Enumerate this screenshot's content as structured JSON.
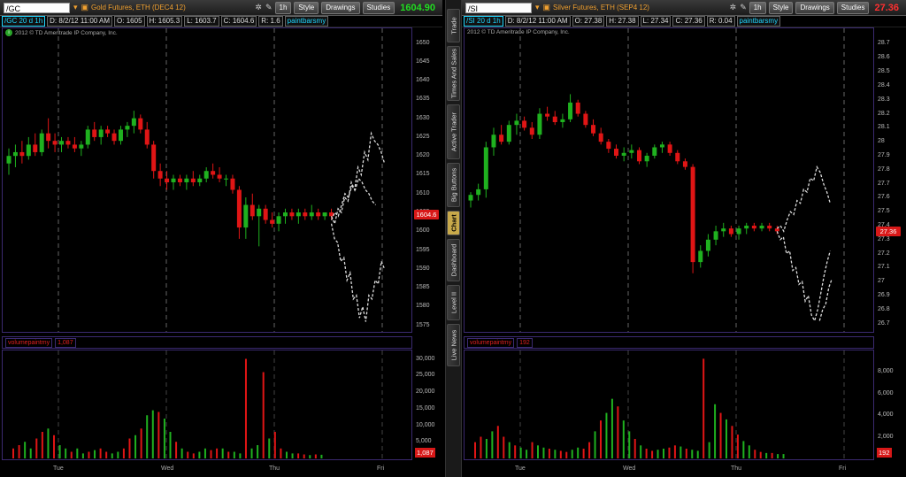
{
  "panels": [
    {
      "id": "gold",
      "symbol": "/GC",
      "description": "Gold Futures, ETH (DEC4 12)",
      "interval_btn": "1h",
      "style_btn": "Style",
      "drawings_btn": "Drawings",
      "studies_btn": "Studies",
      "price": "1604.90",
      "price_color": "#22dd22",
      "change": "",
      "quote": {
        "sym": "/GC 20 d 1h",
        "date": "D: 8/2/12 11:00 AM",
        "open": "O: 1605",
        "high": "H: 1605.3",
        "low": "L: 1603.7",
        "close": "C: 1604.6",
        "range": "R: 1.6",
        "study": "paintbarsmy"
      },
      "copyright": "2012 © TD Ameritrade IP Company, Inc.",
      "yticks": [
        "1650",
        "1645",
        "1640",
        "1635",
        "1630",
        "1625",
        "1620",
        "1615",
        "1610",
        "1605",
        "1600",
        "1595",
        "1590",
        "1585",
        "1580",
        "1575"
      ],
      "ymin": 1574,
      "ymax": 1652,
      "last_label": "1604.6",
      "last_value": 1604.6,
      "volume_study": "volumepaintmy",
      "volume_value": "1,087",
      "vol_ticks": [
        "30,000",
        "25,000",
        "20,000",
        "15,000",
        "10,000",
        "5,000"
      ],
      "vol_max": 32000,
      "xticks": [
        "Tue",
        "Wed",
        "Thu",
        "Fri"
      ],
      "candles": [
        [
          1618,
          1622,
          1615,
          1620
        ],
        [
          1620,
          1623,
          1617,
          1621
        ],
        [
          1621,
          1624,
          1618,
          1620
        ],
        [
          1620,
          1625,
          1619,
          1623
        ],
        [
          1623,
          1626,
          1620,
          1621
        ],
        [
          1621,
          1627,
          1620,
          1626
        ],
        [
          1626,
          1630,
          1622,
          1624
        ],
        [
          1624,
          1626,
          1621,
          1623
        ],
        [
          1623,
          1625,
          1621,
          1624
        ],
        [
          1624,
          1625,
          1622,
          1623
        ],
        [
          1623,
          1625,
          1621,
          1622
        ],
        [
          1622,
          1624,
          1620,
          1623
        ],
        [
          1623,
          1628,
          1622,
          1627
        ],
        [
          1627,
          1629,
          1624,
          1625
        ],
        [
          1625,
          1628,
          1623,
          1627
        ],
        [
          1627,
          1628,
          1625,
          1626
        ],
        [
          1626,
          1627,
          1623,
          1624
        ],
        [
          1624,
          1628,
          1623,
          1627
        ],
        [
          1627,
          1629,
          1625,
          1628
        ],
        [
          1628,
          1632,
          1626,
          1630
        ],
        [
          1630,
          1631,
          1626,
          1627
        ],
        [
          1627,
          1629,
          1622,
          1623
        ],
        [
          1623,
          1624,
          1614,
          1616
        ],
        [
          1616,
          1618,
          1612,
          1614
        ],
        [
          1614,
          1616,
          1611,
          1613
        ],
        [
          1613,
          1615,
          1611,
          1614
        ],
        [
          1614,
          1615,
          1612,
          1613
        ],
        [
          1613,
          1615,
          1611,
          1614
        ],
        [
          1614,
          1616,
          1612,
          1613
        ],
        [
          1613,
          1615,
          1612,
          1614
        ],
        [
          1614,
          1617,
          1613,
          1616
        ],
        [
          1616,
          1618,
          1614,
          1615
        ],
        [
          1615,
          1617,
          1613,
          1614
        ],
        [
          1614,
          1615,
          1612,
          1614
        ],
        [
          1614,
          1615,
          1610,
          1611
        ],
        [
          1611,
          1612,
          1598,
          1601
        ],
        [
          1601,
          1609,
          1598,
          1607
        ],
        [
          1607,
          1610,
          1603,
          1604
        ],
        [
          1604,
          1607,
          1596,
          1606
        ],
        [
          1606,
          1607,
          1602,
          1603
        ],
        [
          1603,
          1605,
          1601,
          1602
        ],
        [
          1602,
          1605,
          1600,
          1604
        ],
        [
          1604,
          1606,
          1602,
          1605
        ],
        [
          1605,
          1606,
          1603,
          1604
        ],
        [
          1604,
          1606,
          1602,
          1605
        ],
        [
          1605,
          1606,
          1603,
          1604
        ],
        [
          1604,
          1607,
          1603,
          1605
        ],
        [
          1605,
          1606,
          1603,
          1604
        ],
        [
          1604,
          1605,
          1603,
          1605
        ],
        [
          1605,
          1606,
          1603,
          1604
        ]
      ],
      "projection_upper": [
        1604,
        1602,
        1606,
        1605,
        1609,
        1608,
        1613,
        1611,
        1617,
        1615,
        1621,
        1619,
        1626,
        1624,
        1623,
        1621,
        1618
      ],
      "projection_mid": [
        1603,
        1605,
        1604,
        1607,
        1610,
        1609,
        1612,
        1611,
        1614,
        1613,
        1611,
        1610,
        1608,
        1607
      ],
      "projection_lower": [
        1602,
        1598,
        1597,
        1592,
        1593,
        1587,
        1589,
        1582,
        1583,
        1577,
        1580,
        1576,
        1583,
        1582,
        1587,
        1586,
        1592,
        1590
      ],
      "volumes": [
        3000,
        4000,
        5000,
        3000,
        6000,
        8000,
        9000,
        7000,
        4000,
        3000,
        2000,
        3000,
        1500,
        2000,
        2500,
        3000,
        2000,
        1500,
        2000,
        3000,
        6000,
        7000,
        9000,
        13000,
        14500,
        14000,
        12000,
        8000,
        5000,
        3000,
        2000,
        1500,
        2000,
        3000,
        2500,
        3000,
        3000,
        2000,
        2000,
        1500,
        30000,
        3000,
        4000,
        26000,
        6000,
        8000,
        3000,
        2000,
        1500,
        1500,
        1200,
        1000,
        1200,
        1100
      ]
    },
    {
      "id": "silver",
      "symbol": "/SI",
      "description": "Silver Futures, ETH (SEP4 12)",
      "interval_btn": "1h",
      "style_btn": "Style",
      "drawings_btn": "Drawings",
      "studies_btn": "Studies",
      "price": "27.36",
      "price_color": "#ff3030",
      "change": "",
      "quote": {
        "sym": "/SI 20 d 1h",
        "date": "D: 8/2/12 11:00 AM",
        "open": "O: 27.38",
        "high": "H: 27.38",
        "low": "L: 27.34",
        "close": "C: 27.36",
        "range": "R: 0.04",
        "study": "paintbarsmy"
      },
      "copyright": "2012 © TD Ameritrade IP Company, Inc.",
      "yticks": [
        "28.7",
        "28.6",
        "28.5",
        "28.4",
        "28.3",
        "28.2",
        "28.1",
        "28",
        "27.9",
        "27.8",
        "27.7",
        "27.6",
        "27.5",
        "27.4",
        "27.3",
        "27.2",
        "27.1",
        "27",
        "26.9",
        "26.8",
        "26.7"
      ],
      "ymin": 26.66,
      "ymax": 28.76,
      "last_label": "27.36",
      "last_value": 27.36,
      "volume_study": "volumepaintmy",
      "volume_value": "192",
      "vol_ticks": [
        "8,000",
        "6,000",
        "4,000",
        "2,000"
      ],
      "vol_max": 9800,
      "xticks": [
        "Tue",
        "Wed",
        "Thu",
        "Fri"
      ],
      "candles": [
        [
          27.58,
          27.64,
          27.53,
          27.62
        ],
        [
          27.62,
          27.7,
          27.58,
          27.66
        ],
        [
          27.66,
          28.0,
          27.6,
          27.96
        ],
        [
          27.96,
          28.1,
          27.9,
          28.05
        ],
        [
          28.05,
          28.12,
          27.98,
          28.0
        ],
        [
          28.0,
          28.15,
          27.98,
          28.12
        ],
        [
          28.12,
          28.2,
          28.05,
          28.15
        ],
        [
          28.15,
          28.18,
          28.08,
          28.1
        ],
        [
          28.1,
          28.14,
          28.02,
          28.05
        ],
        [
          28.05,
          28.24,
          28.02,
          28.2
        ],
        [
          28.2,
          28.25,
          28.15,
          28.18
        ],
        [
          28.18,
          28.22,
          28.12,
          28.14
        ],
        [
          28.14,
          28.2,
          28.1,
          28.16
        ],
        [
          28.16,
          28.34,
          28.14,
          28.28
        ],
        [
          28.28,
          28.3,
          28.18,
          28.2
        ],
        [
          28.2,
          28.22,
          28.1,
          28.12
        ],
        [
          28.12,
          28.16,
          28.04,
          28.06
        ],
        [
          28.06,
          28.1,
          27.98,
          28.0
        ],
        [
          28.0,
          28.02,
          27.92,
          27.95
        ],
        [
          27.95,
          27.98,
          27.88,
          27.9
        ],
        [
          27.9,
          27.96,
          27.86,
          27.92
        ],
        [
          27.92,
          27.98,
          27.88,
          27.94
        ],
        [
          27.94,
          27.96,
          27.84,
          27.86
        ],
        [
          27.86,
          27.92,
          27.82,
          27.9
        ],
        [
          27.9,
          27.98,
          27.88,
          27.96
        ],
        [
          27.96,
          28.0,
          27.92,
          27.98
        ],
        [
          27.98,
          28.0,
          27.9,
          27.92
        ],
        [
          27.92,
          27.94,
          27.84,
          27.86
        ],
        [
          27.86,
          27.88,
          27.8,
          27.82
        ],
        [
          27.82,
          27.84,
          27.06,
          27.14
        ],
        [
          27.14,
          27.26,
          27.1,
          27.22
        ],
        [
          27.22,
          27.34,
          27.18,
          27.3
        ],
        [
          27.3,
          27.4,
          27.26,
          27.36
        ],
        [
          27.36,
          27.42,
          27.32,
          27.38
        ],
        [
          27.38,
          27.4,
          27.32,
          27.34
        ],
        [
          27.34,
          27.4,
          27.3,
          27.38
        ],
        [
          27.38,
          27.42,
          27.34,
          27.4
        ],
        [
          27.4,
          27.42,
          27.36,
          27.38
        ],
        [
          27.38,
          27.42,
          27.36,
          27.4
        ],
        [
          27.4,
          27.42,
          27.36,
          27.38
        ],
        [
          27.38,
          27.4,
          27.34,
          27.36
        ]
      ],
      "projection_upper": [
        27.38,
        27.4,
        27.36,
        27.44,
        27.5,
        27.48,
        27.58,
        27.56,
        27.66,
        27.64,
        27.74,
        27.72,
        27.82,
        27.78,
        27.7,
        27.64,
        27.56
      ],
      "projection_lower": [
        27.36,
        27.3,
        27.32,
        27.2,
        27.22,
        27.08,
        27.1,
        26.98,
        27.0,
        26.86,
        26.9,
        26.76,
        26.72,
        26.8,
        26.92,
        27.04,
        27.14,
        27.22
      ],
      "projection_lower2": [
        26.72,
        26.8,
        26.84,
        26.96,
        27.02
      ],
      "volumes": [
        1500,
        2000,
        1800,
        2500,
        3000,
        2000,
        1500,
        1200,
        1000,
        800,
        1500,
        1200,
        1000,
        900,
        800,
        700,
        600,
        800,
        1000,
        900,
        1500,
        2500,
        3500,
        4200,
        5500,
        4800,
        3500,
        2500,
        1800,
        1200,
        900,
        700,
        800,
        900,
        1000,
        1200,
        1100,
        900,
        800,
        700,
        9200,
        1500,
        5000,
        4200,
        3600,
        3000,
        2200,
        1600,
        1200,
        800,
        600,
        500,
        500,
        400,
        400
      ]
    }
  ],
  "sidebar": {
    "tabs": [
      "Trade",
      "Times And Sales",
      "Active Trader",
      "Big Buttons",
      "Chart",
      "Dashboard",
      "Level II",
      "Live News"
    ],
    "active": "Chart"
  },
  "colors": {
    "up": "#1fb11f",
    "down": "#e01515",
    "projection": "#dddddd",
    "grid_dash": "#666666",
    "panel_border": "#3b2a70"
  }
}
